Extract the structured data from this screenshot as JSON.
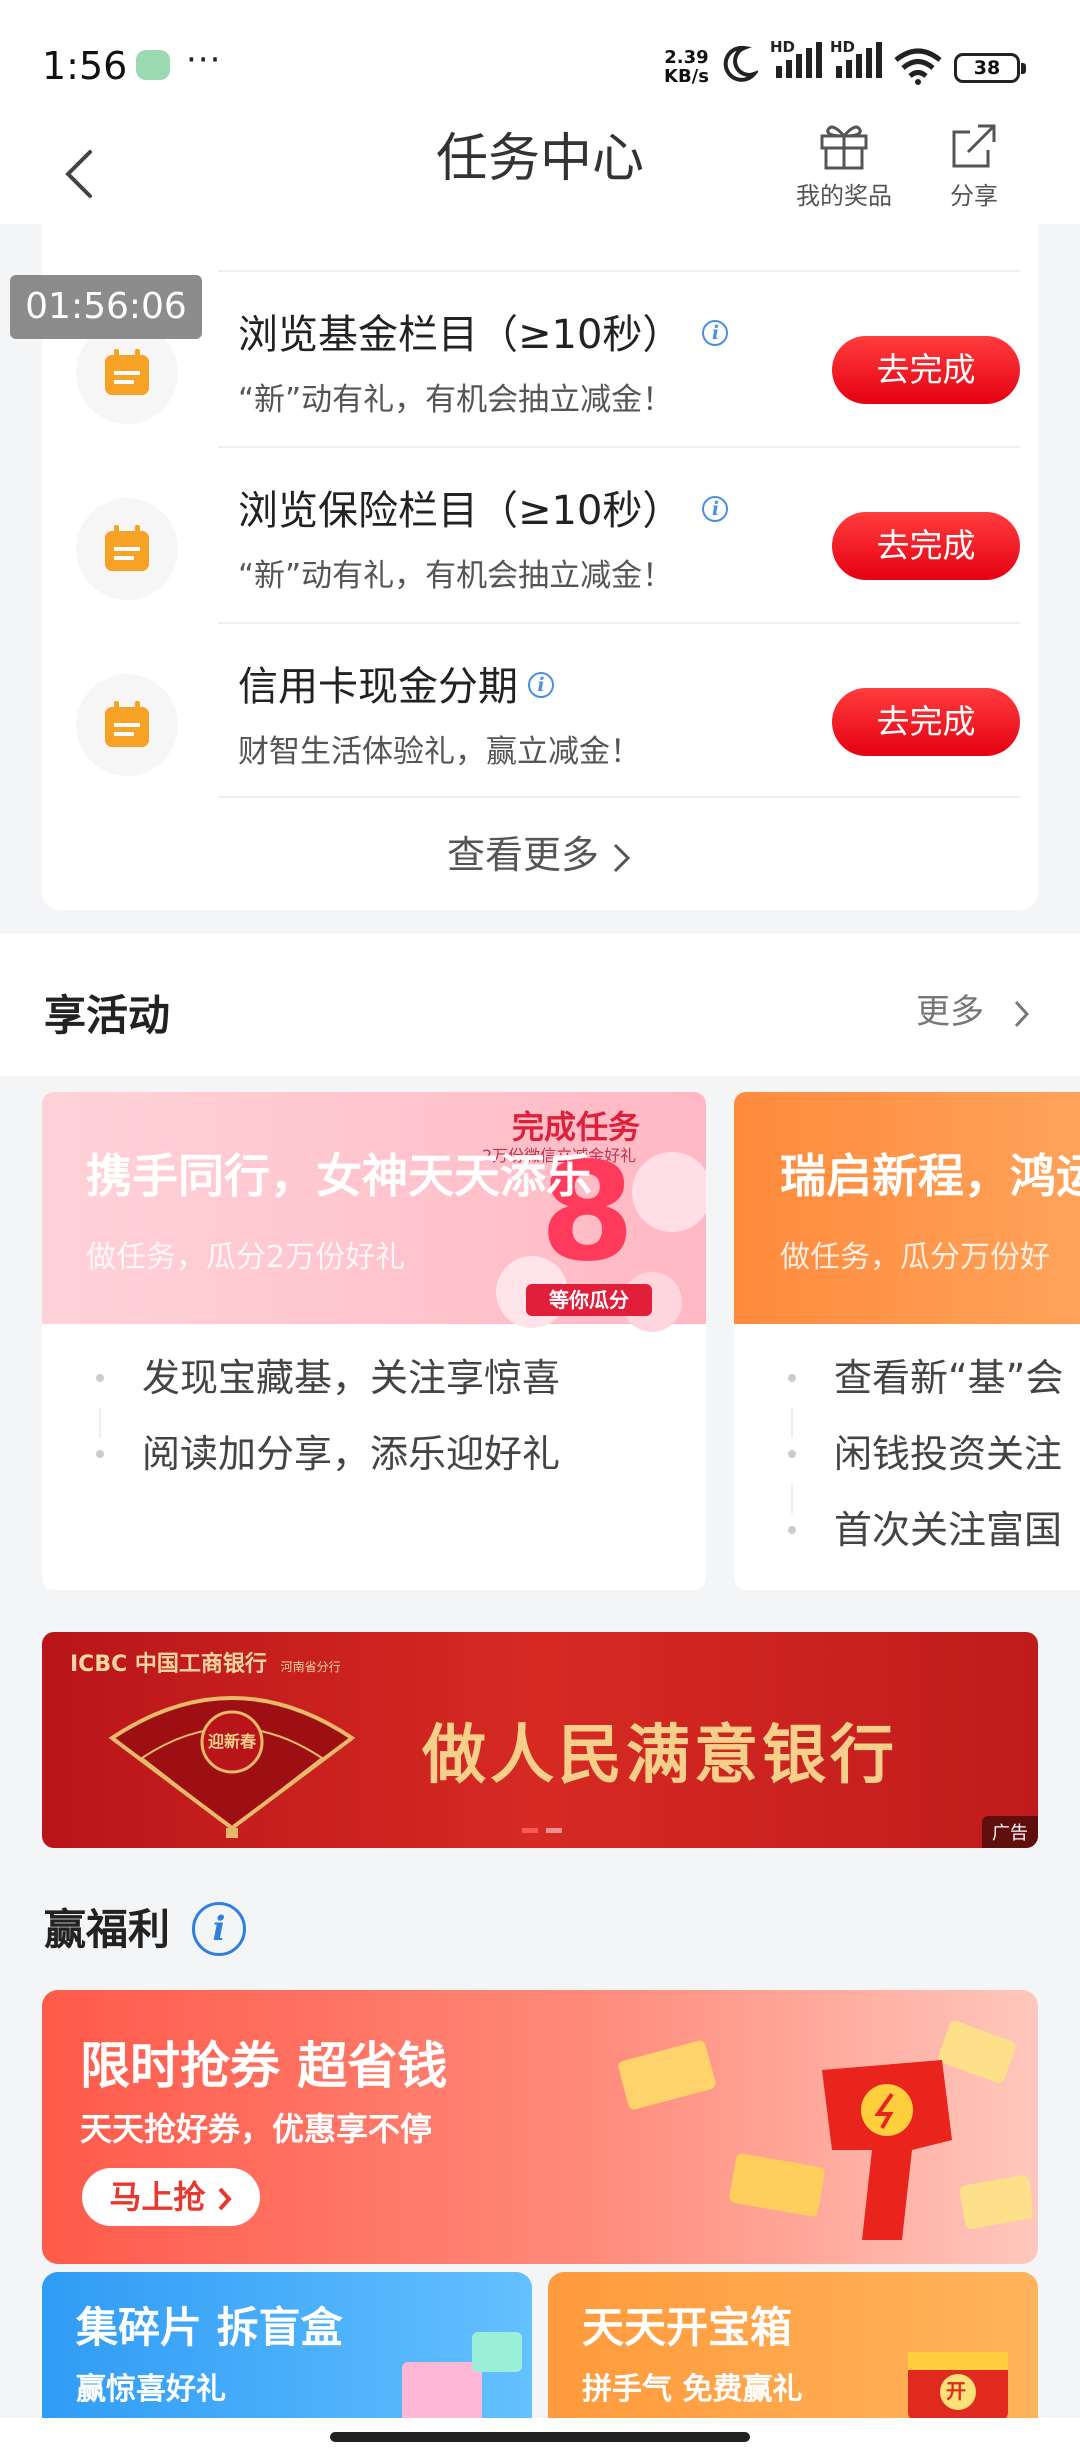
{
  "status_bar": {
    "time": "1:56",
    "more": "···",
    "net_speed_value": "2.39",
    "net_speed_unit": "KB/s",
    "signal_1_label": "HD",
    "signal_2_label": "HD",
    "battery": "38"
  },
  "nav": {
    "title": "任务中心",
    "prizes_label": "我的奖品",
    "share_label": "分享"
  },
  "timer_overlay": "01:56:06",
  "tasks": [
    {
      "title": "浏览基金栏目（≥10秒）",
      "subtitle": "“新”动有礼，有机会抽立减金！",
      "button": "去完成"
    },
    {
      "title": "浏览保险栏目（≥10秒）",
      "subtitle": "“新”动有礼，有机会抽立减金！",
      "button": "去完成"
    },
    {
      "title": "信用卡现金分期",
      "subtitle": "财智生活体验礼，赢立减金！",
      "button": "去完成"
    }
  ],
  "tasks_more": "查看更多",
  "activities": {
    "title": "享活动",
    "more": "更多",
    "cards": [
      {
        "banner_title": "携手同行，女神天天添乐",
        "banner_sub": "做任务，瓜分2万份好礼",
        "badge_title": "完成任务",
        "badge_sub": "2万份微信立减金好礼",
        "badge_number": "8",
        "badge_button": "等你瓜分",
        "items": [
          "发现宝藏基，关注享惊喜",
          "阅读加分享，添乐迎好礼"
        ]
      },
      {
        "banner_title": "瑞启新程，鸿运",
        "banner_sub": "做任务，瓜分万份好",
        "items": [
          "查看新“基”会",
          "闲钱投资关注",
          "首次关注富国"
        ]
      }
    ]
  },
  "ad": {
    "logo": "ICBC 中国工商银行",
    "logo_sub": "河南省分行",
    "slogan": "做人民满意银行",
    "tag": "广告",
    "fan_text": "迎新春"
  },
  "welfare": {
    "title": "赢福利",
    "big_promo": {
      "title": "限时抢券 超省钱",
      "subtitle": "天天抢好券，优惠享不停",
      "button": "马上抢"
    },
    "small_promos": [
      {
        "title": "集碎片 拆盲盒",
        "subtitle": "赢惊喜好礼"
      },
      {
        "title": "天天开宝箱",
        "subtitle": "拼手气 免费赢礼",
        "chest_text": "开"
      }
    ]
  },
  "colors": {
    "primary_red": "#e60012",
    "info_blue": "#4b8fe0",
    "task_icon_orange": "#f7a225"
  }
}
